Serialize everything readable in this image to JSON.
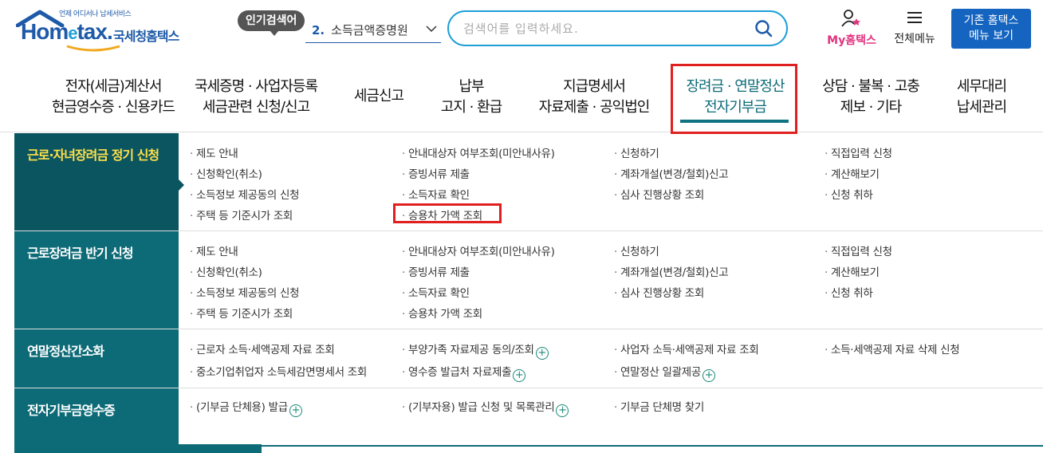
{
  "header": {
    "logo_sub": "언제 어디서나 납세서비스",
    "logo_word_a": "Hom",
    "logo_word_e": "e",
    "logo_word_b": "tax.",
    "logo_org": "국세청홈택스",
    "popular_badge": "인기검색어",
    "popular_num": "2.",
    "popular_term": "소득금액증명원",
    "search_placeholder": "검색어를 입력하세요.",
    "myhome_label": "My홈택스",
    "allmenu_label": "전체메뉴",
    "oldmenu_line1": "기존 홈택스",
    "oldmenu_line2": "메뉴 보기"
  },
  "gnb": [
    {
      "line1": "전자(세금)계산서",
      "line2": "현금영수증 · 신용카드"
    },
    {
      "line1": "국세증명 · 사업자등록",
      "line2": "세금관련 신청/신고"
    },
    {
      "line1": "세금신고",
      "line2": ""
    },
    {
      "line1": "납부",
      "line2": "고지 · 환급"
    },
    {
      "line1": "지급명세서",
      "line2": "자료제출 · 공익법인"
    },
    {
      "line1": "장려금 · 연말정산",
      "line2": "전자기부금"
    },
    {
      "line1": "상담 · 불복 · 고충",
      "line2": "제보 · 기타"
    },
    {
      "line1": "세무대리",
      "line2": "납세관리"
    }
  ],
  "sections": [
    {
      "title": "근로·자녀장려금 정기 신청",
      "links": [
        "제도 안내",
        "안내대상자 여부조회(미안내사유)",
        "신청하기",
        "직접입력 신청",
        "신청확인(취소)",
        "증빙서류 제출",
        "계좌개설(변경/철회)신고",
        "계산해보기",
        "소득정보 제공동의 신청",
        "소득자료 확인",
        "심사 진행상황 조회",
        "신청 취하",
        "주택 등 기준시가 조회",
        "승용차 가액 조회"
      ]
    },
    {
      "title": "근로장려금 반기 신청",
      "links": [
        "제도 안내",
        "안내대상자 여부조회(미안내사유)",
        "신청하기",
        "직접입력 신청",
        "신청확인(취소)",
        "증빙서류 제출",
        "계좌개설(변경/철회)신고",
        "계산해보기",
        "소득정보 제공동의 신청",
        "소득자료 확인",
        "심사 진행상황 조회",
        "신청 취하",
        "주택 등 기준시가 조회",
        "승용차 가액 조회"
      ]
    },
    {
      "title": "연말정산간소화",
      "links": [
        "근로자 소득·세액공제 자료 조회",
        "부양가족 자료제공 동의/조회",
        "사업자 소득·세액공제 자료 조회",
        "소득·세액공제 자료 삭제 신청",
        "중소기업취업자 소득세감면명세서 조회",
        "영수증 발급처 자료제출",
        "연말정산 일괄제공"
      ]
    },
    {
      "title": "전자기부금영수증",
      "links": [
        "(기부금 단체용) 발급",
        "(기부자용) 발급 신청 및 목록관리",
        "기부금 단체명 찾기"
      ]
    }
  ],
  "dot": "·",
  "plus": "+",
  "colors": {
    "teal": "#0d6b77",
    "accent_blue": "#1e9fd6",
    "highlight_red": "#e02020",
    "my_pink": "#e0347f"
  }
}
